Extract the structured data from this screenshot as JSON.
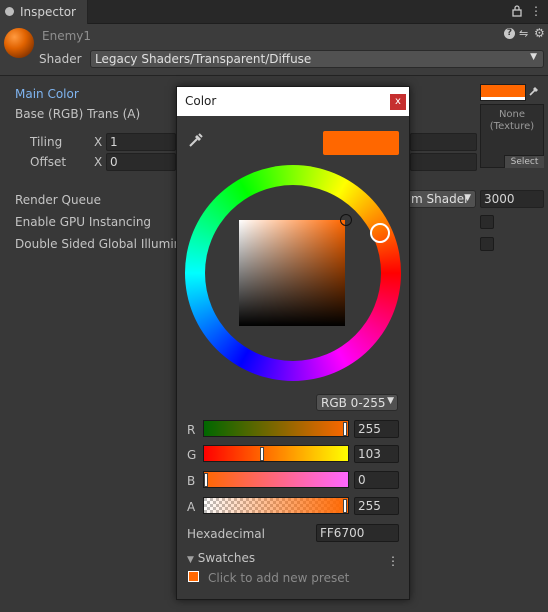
{
  "tab": {
    "title": "Inspector"
  },
  "tab_icons": {
    "lock": "🔒",
    "menu": "⋮"
  },
  "material": {
    "name": "Enemy1",
    "shader_label": "Shader",
    "shader_value": "Legacy Shaders/Transparent/Diffuse",
    "header_icons": {
      "help": "❓",
      "settings": "⇋",
      "gear": "⚙"
    }
  },
  "properties": {
    "main_color": "Main Color",
    "base_rgb": "Base (RGB) Trans (A)",
    "tiling": {
      "label": "Tiling",
      "x_label": "X",
      "x_value": "1"
    },
    "offset": {
      "label": "Offset",
      "x_label": "X",
      "x_value": "0"
    },
    "texture": {
      "line1": "None",
      "line2": "(Texture)",
      "select": "Select"
    },
    "render_queue": {
      "label": "Render Queue",
      "mode": "m Shader",
      "value": "3000"
    },
    "gpu_instancing": "Enable GPU Instancing",
    "double_sided_gi": "Double Sided Global Illumina"
  },
  "color_dialog": {
    "title": "Color",
    "close": "x",
    "mode": "RGB 0-255",
    "channels": [
      {
        "label": "R",
        "value": "255"
      },
      {
        "label": "G",
        "value": "103"
      },
      {
        "label": "B",
        "value": "0"
      },
      {
        "label": "A",
        "value": "255"
      }
    ],
    "channel_fraction": [
      1.0,
      0.404,
      0.0,
      1.0
    ],
    "hex_label": "Hexadecimal",
    "hex_value": "FF6700",
    "swatches_label": "Swatches",
    "preset_text": "Click to add new preset",
    "current_color": "#FF6700"
  },
  "colors": {
    "accent_blue": "#7FB4F0",
    "orange": "#FF6700",
    "close_red": "#C62F2F"
  }
}
